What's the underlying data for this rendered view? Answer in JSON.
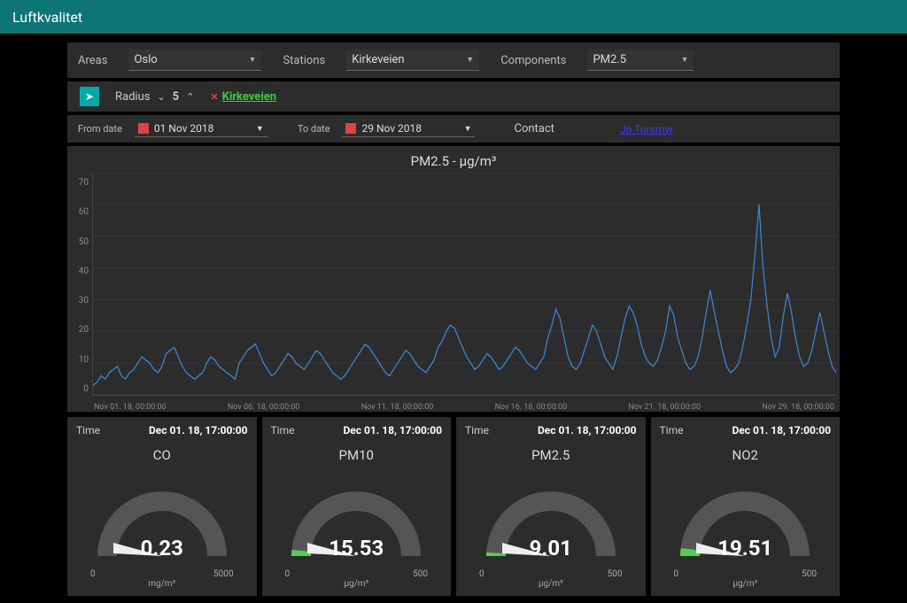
{
  "header": {
    "title": "Luftkvalitet"
  },
  "filters": {
    "area_label": "Areas",
    "area_value": "Oslo",
    "station_label": "Stations",
    "station_value": "Kirkeveien",
    "component_label": "Components",
    "component_value": "PM2.5"
  },
  "radius": {
    "label": "Radius",
    "value": "5",
    "station_link": "Kirkeveien"
  },
  "dates": {
    "from_label": "From date",
    "from_value": "01 Nov 2018",
    "to_label": "To date",
    "to_value": "29 Nov 2018",
    "contact_label": "Contact",
    "contact_value": "Jo Torsmyr"
  },
  "chart": {
    "title": "PM2.5 - µg/m³",
    "yticks": [
      "70",
      "60",
      "50",
      "40",
      "30",
      "20",
      "10",
      "0"
    ],
    "xticks": [
      "Nov 01. 18, 00:00:00",
      "Nov 06. 18, 00:00:00",
      "Nov 11. 18, 00:00:00",
      "Nov 16. 18, 00:00:00",
      "Nov 21. 18, 00:00:00",
      "Nov 29. 18, 00:00:00"
    ]
  },
  "chart_data": {
    "type": "line",
    "title": "PM2.5 - µg/m³",
    "xlabel": "",
    "ylabel": "",
    "ylim": [
      0,
      70
    ],
    "x_start": "2018-11-01T00:00:00",
    "x_end": "2018-11-29T00:00:00",
    "values": [
      3,
      4,
      6,
      5,
      7,
      8,
      9,
      6,
      5,
      7,
      8,
      10,
      12,
      11,
      10,
      8,
      7,
      9,
      13,
      14,
      15,
      12,
      9,
      7,
      6,
      5,
      6,
      7,
      10,
      12,
      11,
      9,
      8,
      7,
      6,
      5,
      10,
      12,
      14,
      15,
      16,
      13,
      10,
      8,
      6,
      7,
      9,
      11,
      13,
      12,
      10,
      9,
      8,
      10,
      12,
      14,
      13,
      11,
      9,
      7,
      6,
      5,
      6,
      8,
      10,
      12,
      14,
      16,
      15,
      13,
      11,
      9,
      7,
      6,
      8,
      10,
      12,
      14,
      13,
      11,
      9,
      8,
      7,
      9,
      11,
      15,
      17,
      20,
      22,
      21,
      18,
      15,
      12,
      10,
      8,
      9,
      11,
      13,
      12,
      10,
      8,
      9,
      11,
      13,
      15,
      14,
      12,
      10,
      9,
      8,
      10,
      12,
      18,
      22,
      27,
      24,
      18,
      12,
      9,
      8,
      10,
      14,
      18,
      22,
      20,
      16,
      12,
      10,
      8,
      12,
      18,
      24,
      28,
      26,
      22,
      16,
      12,
      10,
      9,
      11,
      15,
      20,
      28,
      25,
      18,
      14,
      10,
      8,
      9,
      12,
      18,
      26,
      33,
      26,
      20,
      14,
      9,
      7,
      8,
      10,
      15,
      22,
      30,
      44,
      60,
      40,
      28,
      18,
      12,
      15,
      25,
      32,
      26,
      18,
      12,
      9,
      10,
      14,
      20,
      26,
      20,
      14,
      9,
      7
    ]
  },
  "gauges": [
    {
      "time_label": "Time",
      "time_value": "Dec 01. 18, 17:00:00",
      "name": "CO",
      "value": "0.23",
      "min": "0",
      "max": "5000",
      "unit": "mg/m³",
      "frac": 5e-05
    },
    {
      "time_label": "Time",
      "time_value": "Dec 01. 18, 17:00:00",
      "name": "PM10",
      "value": "15.53",
      "min": "0",
      "max": "500",
      "unit": "µg/m³",
      "frac": 0.031
    },
    {
      "time_label": "Time",
      "time_value": "Dec 01. 18, 17:00:00",
      "name": "PM2.5",
      "value": "9.01",
      "min": "0",
      "max": "500",
      "unit": "µg/m³",
      "frac": 0.018
    },
    {
      "time_label": "Time",
      "time_value": "Dec 01. 18, 17:00:00",
      "name": "NO2",
      "value": "19.51",
      "min": "0",
      "max": "500",
      "unit": "µg/m³",
      "frac": 0.039
    }
  ]
}
